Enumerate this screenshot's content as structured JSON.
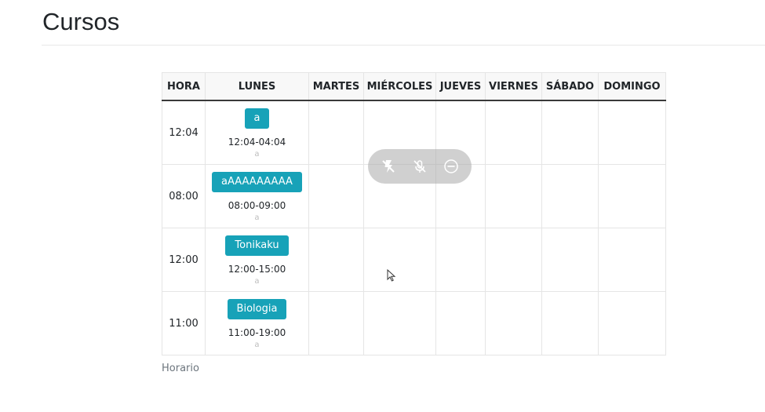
{
  "header": {
    "title": "Cursos"
  },
  "schedule": {
    "columns": [
      "HORA",
      "LUNES",
      "MARTES",
      "MIÉRCOLES",
      "JUEVES",
      "VIERNES",
      "SÁBADO",
      "DOMINGO"
    ],
    "rows": [
      {
        "time": "12:04",
        "course": {
          "name": "a",
          "range": "12:04-04:04",
          "sub": "a"
        }
      },
      {
        "time": "08:00",
        "course": {
          "name": "aAAAAAAAAA",
          "range": "08:00-09:00",
          "sub": "a"
        }
      },
      {
        "time": "12:00",
        "course": {
          "name": "Tonikaku",
          "range": "12:00-15:00",
          "sub": "a"
        }
      },
      {
        "time": "11:00",
        "course": {
          "name": "Biologia",
          "range": "11:00-19:00",
          "sub": "a"
        }
      }
    ],
    "caption": "Horario"
  },
  "overlay": {
    "icons": [
      "flash-off-icon",
      "mic-off-icon",
      "minus-circle-icon"
    ]
  }
}
